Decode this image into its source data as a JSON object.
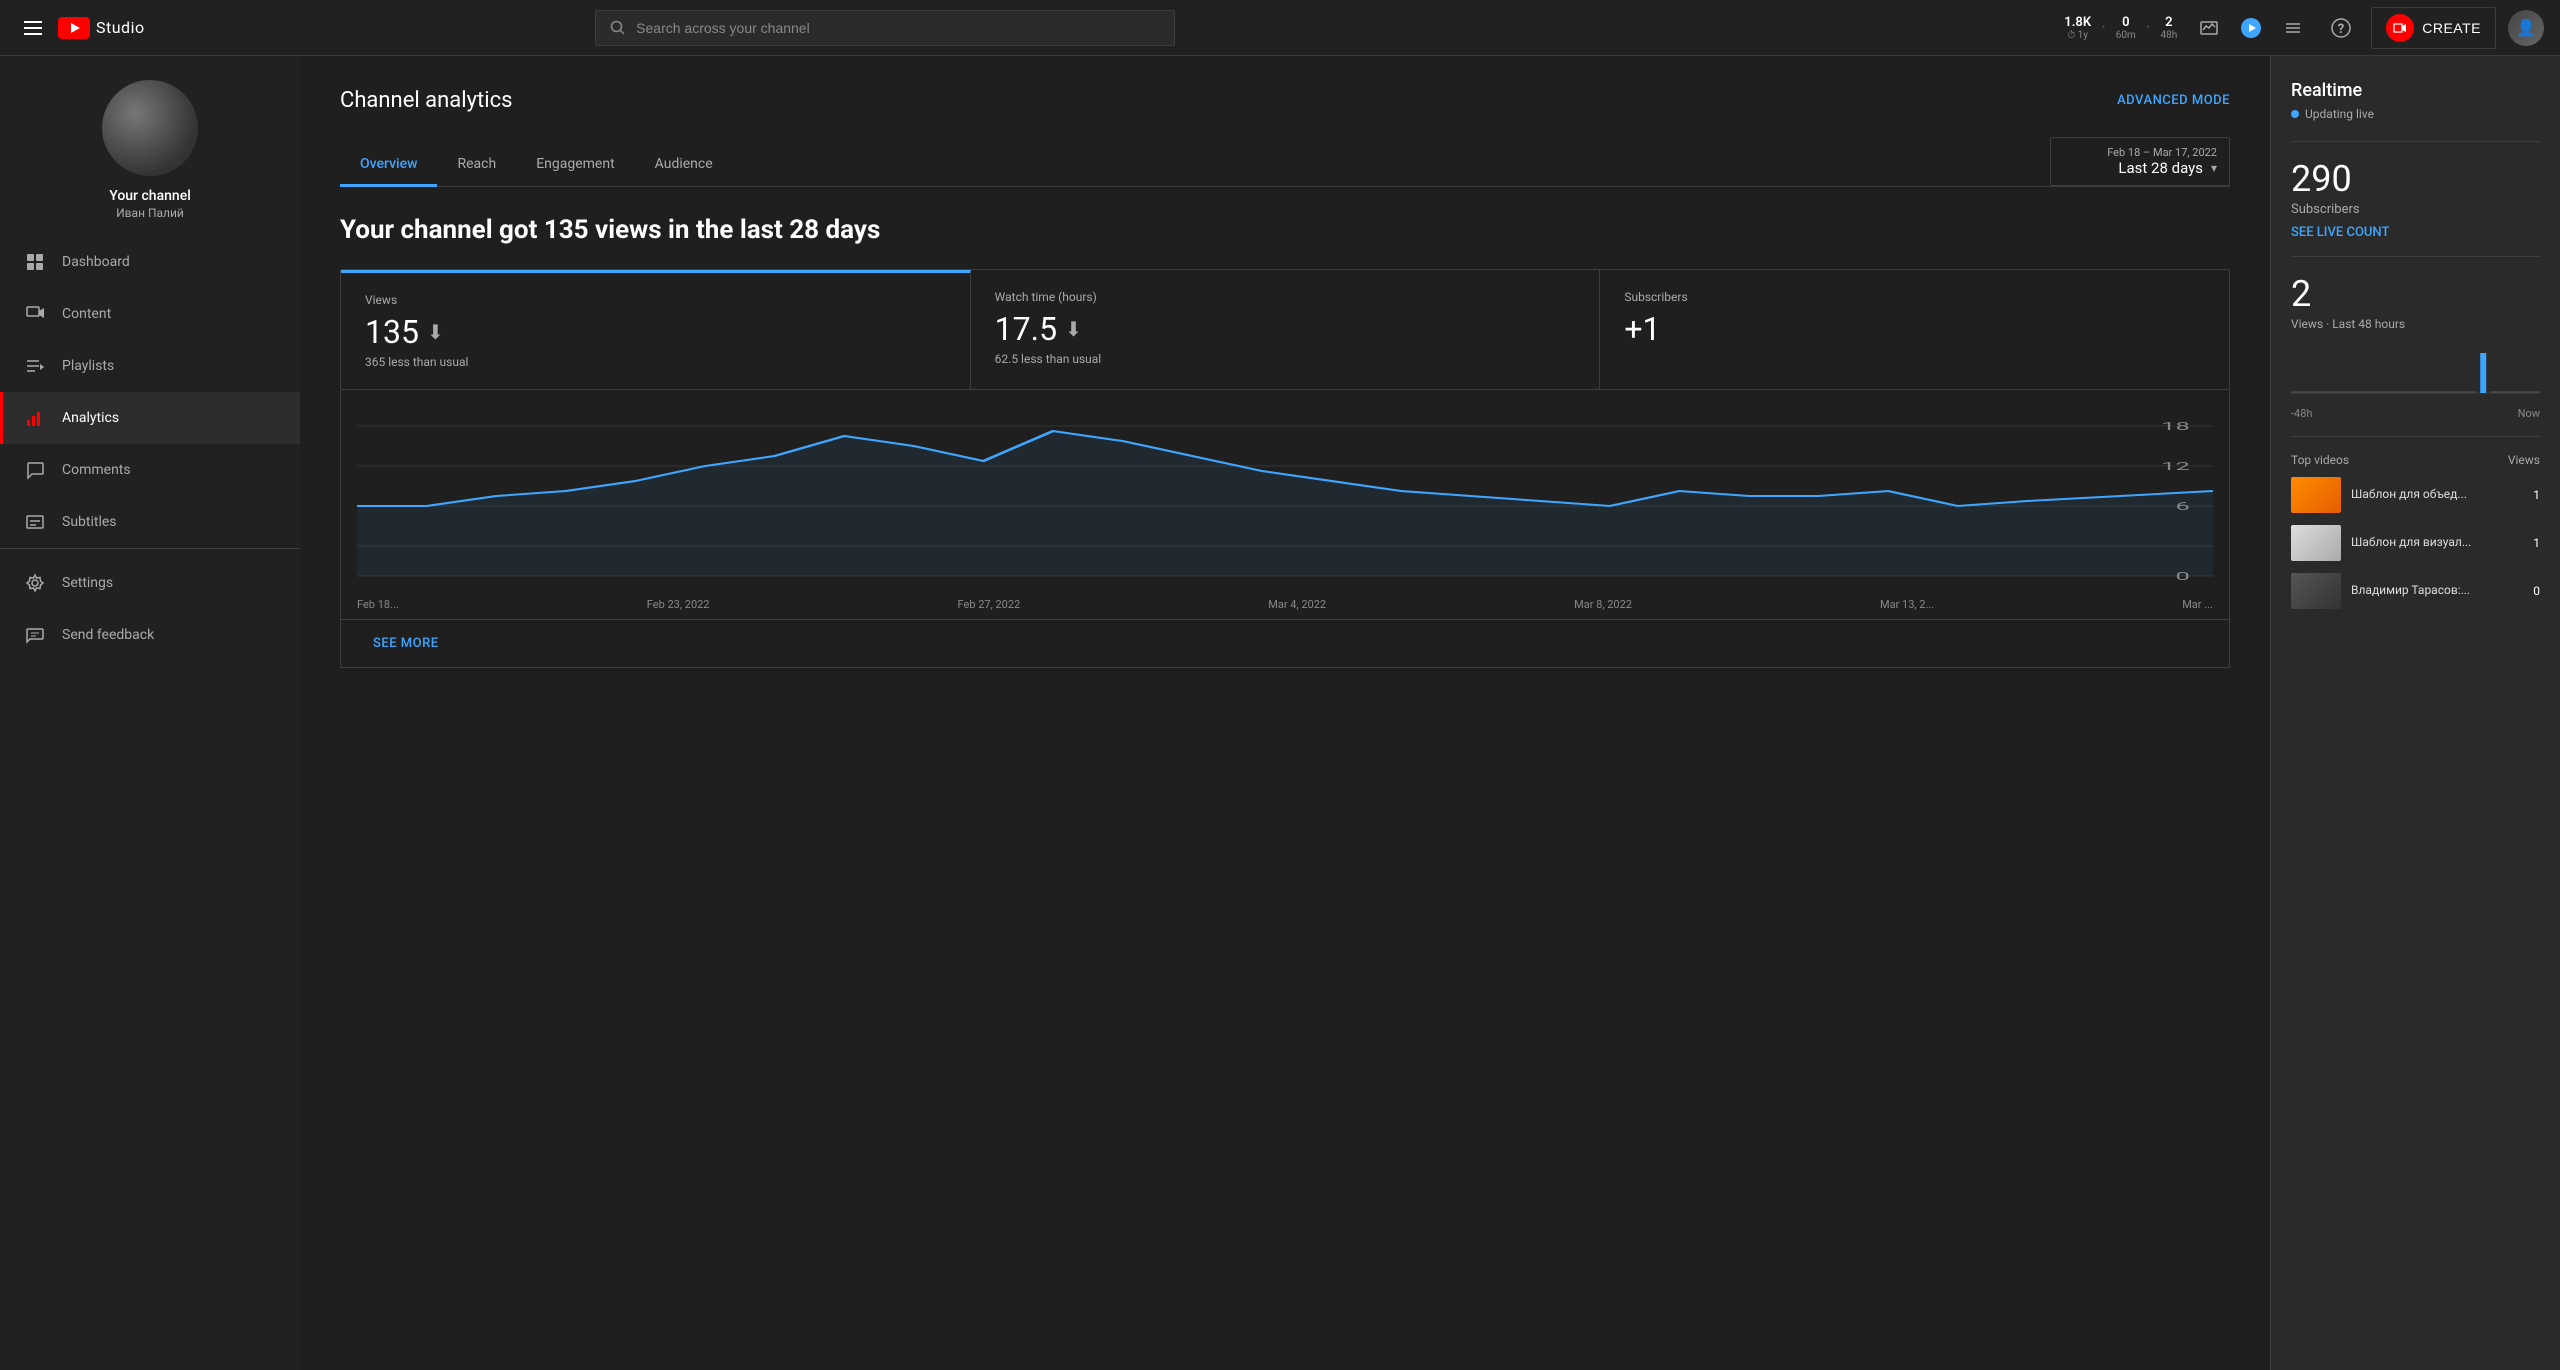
{
  "topbar": {
    "logo_text": "Studio",
    "search_placeholder": "Search across your channel",
    "stats": [
      {
        "value": "1.8K",
        "label": "1y",
        "icon": "clock"
      },
      {
        "value": "0",
        "label": "60m"
      },
      {
        "value": "2",
        "label": "48h"
      }
    ],
    "create_label": "CREATE",
    "help_icon": "question-mark",
    "menu_icon": "menu-dots"
  },
  "sidebar": {
    "channel_name": "Your channel",
    "channel_subname": "Иван Палий",
    "nav_items": [
      {
        "id": "dashboard",
        "label": "Dashboard",
        "icon": "dashboard"
      },
      {
        "id": "content",
        "label": "Content",
        "icon": "content"
      },
      {
        "id": "playlists",
        "label": "Playlists",
        "icon": "playlists"
      },
      {
        "id": "analytics",
        "label": "Analytics",
        "icon": "analytics",
        "active": true
      },
      {
        "id": "comments",
        "label": "Comments",
        "icon": "comments"
      },
      {
        "id": "subtitles",
        "label": "Subtitles",
        "icon": "subtitles"
      },
      {
        "id": "settings",
        "label": "Settings",
        "icon": "settings"
      },
      {
        "id": "send-feedback",
        "label": "Send feedback",
        "icon": "feedback"
      }
    ]
  },
  "analytics": {
    "page_title": "Channel analytics",
    "advanced_mode_label": "ADVANCED MODE",
    "date_range_label": "Feb 18 – Mar 17, 2022",
    "date_range_value": "Last 28 days",
    "tabs": [
      {
        "id": "overview",
        "label": "Overview",
        "active": true
      },
      {
        "id": "reach",
        "label": "Reach"
      },
      {
        "id": "engagement",
        "label": "Engagement"
      },
      {
        "id": "audience",
        "label": "Audience"
      }
    ],
    "summary_title": "Your channel got 135 views in the last 28 days",
    "stats_cards": [
      {
        "label": "Views",
        "value": "135",
        "has_arrow": true,
        "change": "365 less than usual"
      },
      {
        "label": "Watch time (hours)",
        "value": "17.5",
        "has_arrow": true,
        "change": "62.5 less than usual"
      },
      {
        "label": "Subscribers",
        "value": "+1",
        "has_arrow": false,
        "change": ""
      }
    ],
    "chart": {
      "dates": [
        "Feb 18...",
        "Feb 23, 2022",
        "Feb 27, 2022",
        "Mar 4, 2022",
        "Mar 8, 2022",
        "Mar 13, 2...",
        "Mar ..."
      ],
      "y_labels": [
        "18",
        "12",
        "6",
        "0"
      ]
    },
    "see_more_label": "SEE MORE"
  },
  "realtime": {
    "title": "Realtime",
    "live_label": "Updating live",
    "subscribers_value": "290",
    "subscribers_label": "Subscribers",
    "see_live_label": "SEE LIVE COUNT",
    "views_count": "2",
    "views_label": "Views · Last 48 hours",
    "chart_left": "-48h",
    "chart_right": "Now",
    "top_videos_label": "Top videos",
    "views_col_label": "Views",
    "top_videos": [
      {
        "title": "Шаблон для объед...",
        "views": "1",
        "thumb_type": "orange"
      },
      {
        "title": "Шаблон для визуал...",
        "views": "1",
        "thumb_type": "white"
      },
      {
        "title": "Владимир Тарасов:...",
        "views": "0",
        "thumb_type": "person"
      }
    ]
  }
}
